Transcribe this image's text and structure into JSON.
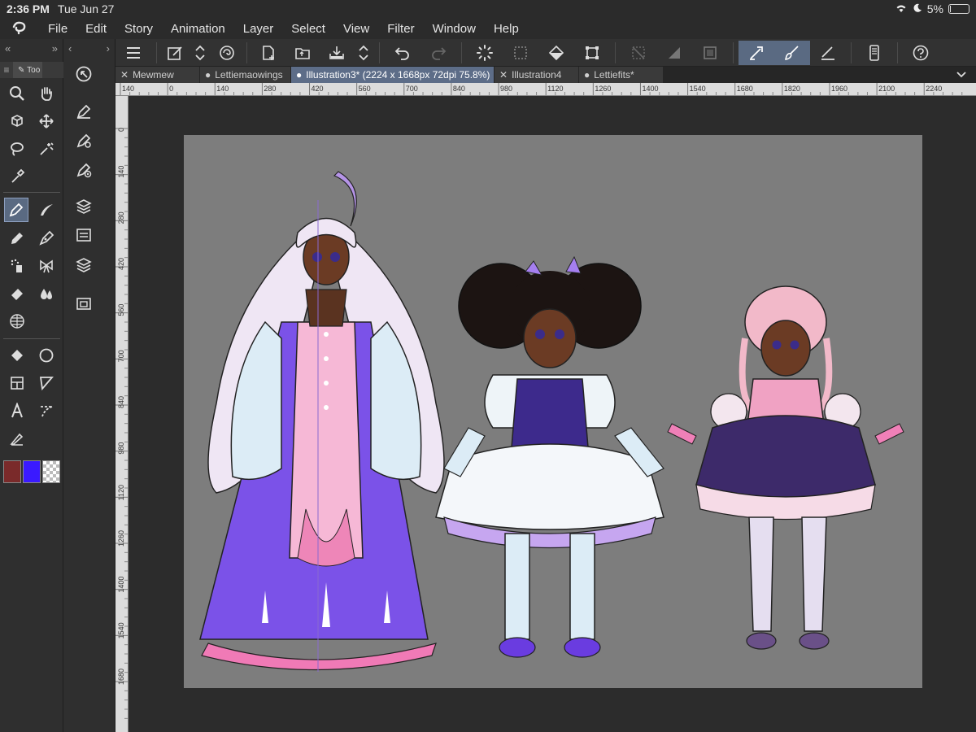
{
  "status": {
    "time": "2:36 PM",
    "date": "Tue Jun 27",
    "battery": "5%",
    "battery_level": 0.05
  },
  "menu": {
    "items": [
      "File",
      "Edit",
      "Story",
      "Animation",
      "Layer",
      "Select",
      "View",
      "Filter",
      "Window",
      "Help"
    ]
  },
  "left_panel": {
    "tab_label": "Too"
  },
  "tabs": [
    {
      "label": "Mewmew",
      "active": false
    },
    {
      "label": "Lettiemaowings",
      "active": false
    },
    {
      "label": "Illustration3* (2224 x 1668px 72dpi 75.8%)",
      "active": true
    },
    {
      "label": "Illustration4",
      "active": false
    },
    {
      "label": "Lettiefits*",
      "active": false
    }
  ],
  "ruler": {
    "h_ticks": [
      "140",
      "0",
      "140",
      "280",
      "420",
      "560",
      "700",
      "840",
      "980",
      "1120",
      "1260",
      "1400",
      "1540",
      "1680",
      "1820",
      "1960",
      "2100",
      "2240"
    ],
    "v_ticks": [
      "0",
      "140",
      "280",
      "420",
      "560",
      "700",
      "840",
      "980",
      "1120",
      "1260",
      "1400",
      "1540",
      "1680"
    ]
  },
  "colors": {
    "main": "#7a2a2a",
    "sub": "#3a1aff",
    "accent": "#5a6a82",
    "canvas_bg": "#7d7d7d"
  },
  "icons": {
    "toolbar": [
      "menu-icon",
      "new-canvas-icon",
      "resize-arrows-icon",
      "spiral-icon",
      "new-file-icon",
      "open-folder-icon",
      "save-icon",
      "save-arrows-icon",
      "undo-icon",
      "redo-icon",
      "loading-icon",
      "selection-icon",
      "fill-icon",
      "transform-icon",
      "deselect-icon",
      "gradient-icon",
      "select-all-icon",
      "pen-pressure-icon",
      "brush-icon",
      "ruler-pen-icon",
      "device-icon",
      "help-icon"
    ]
  }
}
